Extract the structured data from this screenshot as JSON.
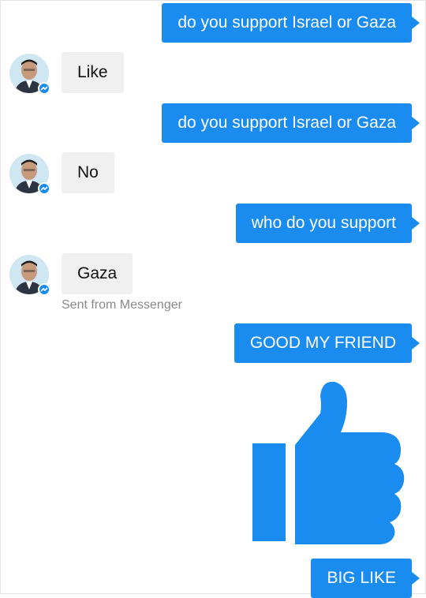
{
  "conversation": {
    "messages": [
      {
        "direction": "outgoing",
        "text": "do you support Israel or Gaza"
      },
      {
        "direction": "incoming",
        "text": "Like"
      },
      {
        "direction": "outgoing",
        "text": "do you support Israel or Gaza"
      },
      {
        "direction": "incoming",
        "text": "No"
      },
      {
        "direction": "outgoing",
        "text": "who do you support"
      },
      {
        "direction": "incoming",
        "text": "Gaza"
      },
      {
        "direction": "outgoing",
        "text": "GOOD MY FRIEND"
      },
      {
        "direction": "outgoing",
        "text": "BIG LIKE"
      }
    ],
    "sent_from": "Sent from Messenger",
    "like_sticker_icon": "thumbs-up-icon",
    "avatar_badge_icon": "messenger-badge-icon"
  },
  "colors": {
    "outgoing_bubble": "#1a8cf0",
    "incoming_bubble": "#f0f0f0",
    "thumb": "#1a8cf0"
  }
}
